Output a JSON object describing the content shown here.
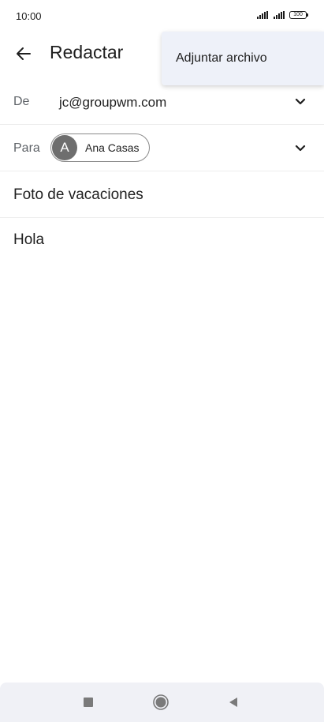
{
  "status_bar": {
    "time": "10:00",
    "battery": "100"
  },
  "app_bar": {
    "title": "Redactar",
    "back_icon": "arrow-back-icon"
  },
  "overflow_menu": {
    "items": [
      {
        "label": "Adjuntar archivo"
      }
    ]
  },
  "compose": {
    "from": {
      "label": "De",
      "value": "jc@groupwm.com"
    },
    "to": {
      "label": "Para",
      "recipients": [
        {
          "initial": "A",
          "name": "Ana Casas"
        }
      ]
    },
    "subject": "Foto de vacaciones",
    "body": "Hola"
  },
  "nav_bar": {
    "buttons": [
      "recents-icon",
      "home-icon",
      "back-icon"
    ]
  },
  "colors": {
    "menu_background": "#eef1f9",
    "avatar_background": "#6e6e6e",
    "nav_background": "#f0f1f6"
  }
}
